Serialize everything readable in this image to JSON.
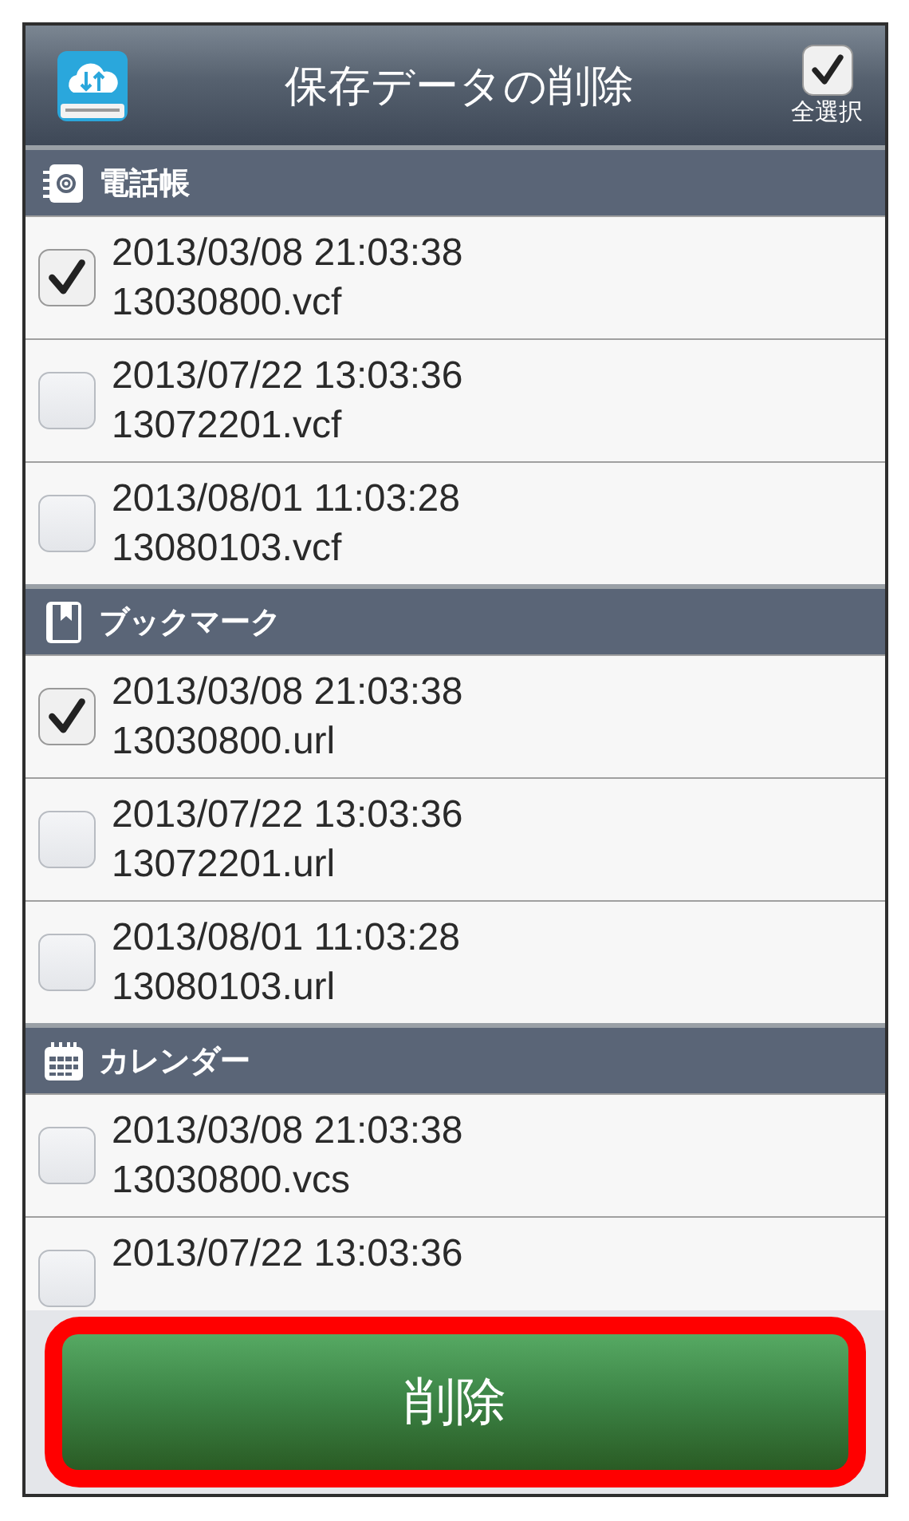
{
  "header": {
    "title": "保存データの削除",
    "select_all": {
      "label": "全選択",
      "checked": true
    }
  },
  "sections": [
    {
      "kind": "contacts",
      "title": "電話帳",
      "items": [
        {
          "date": "2013/03/08 21:03:38",
          "file": "13030800.vcf",
          "checked": true
        },
        {
          "date": "2013/07/22 13:03:36",
          "file": "13072201.vcf",
          "checked": false
        },
        {
          "date": "2013/08/01 11:03:28",
          "file": "13080103.vcf",
          "checked": false
        }
      ]
    },
    {
      "kind": "bookmark",
      "title": "ブックマーク",
      "items": [
        {
          "date": "2013/03/08 21:03:38",
          "file": "13030800.url",
          "checked": true
        },
        {
          "date": "2013/07/22 13:03:36",
          "file": "13072201.url",
          "checked": false
        },
        {
          "date": "2013/08/01 11:03:28",
          "file": "13080103.url",
          "checked": false
        }
      ]
    },
    {
      "kind": "calendar",
      "title": "カレンダー",
      "items": [
        {
          "date": "2013/03/08 21:03:38",
          "file": "13030800.vcs",
          "checked": false
        },
        {
          "date": "2013/07/22 13:03:36",
          "checked": false
        }
      ]
    }
  ],
  "delete_button": {
    "label": "削除",
    "highlighted": true
  }
}
